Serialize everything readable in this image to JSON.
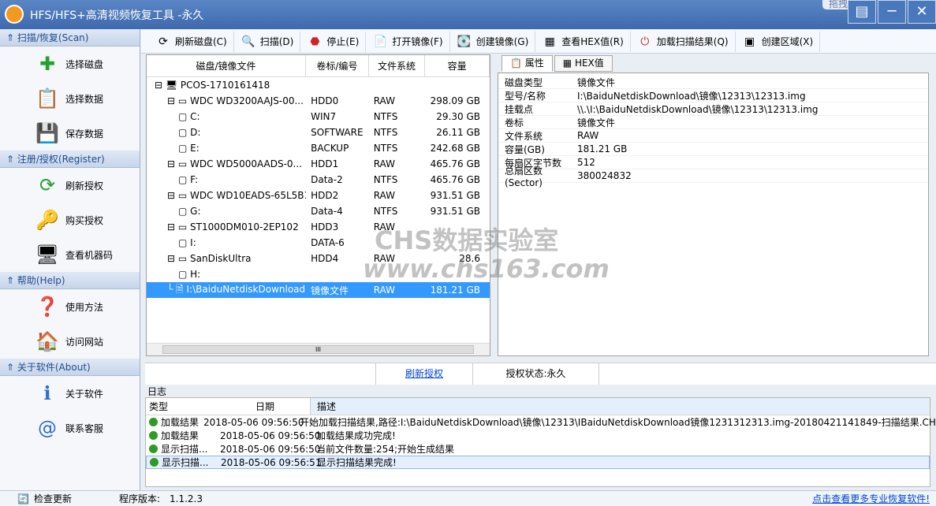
{
  "window": {
    "title": "HFS/HFS+高清视频恢复工具 -永久",
    "tag": "拖拽上传"
  },
  "sidebar": {
    "sections": [
      {
        "title": "扫描/恢复(Scan)",
        "items": [
          "选择磁盘",
          "选择数据",
          "保存数据"
        ]
      },
      {
        "title": "注册/授权(Register)",
        "items": [
          "刷新授权",
          "购买授权",
          "查看机器码"
        ]
      },
      {
        "title": "帮助(Help)",
        "items": [
          "使用方法",
          "访问网站"
        ]
      },
      {
        "title": "关于软件(About)",
        "items": [
          "关于软件",
          "联系客服"
        ]
      }
    ]
  },
  "toolbar": [
    "刷新磁盘(C)",
    "扫描(D)",
    "停止(E)",
    "打开镜像(F)",
    "创建镜像(G)",
    "查看HEX值(R)",
    "加载扫描结果(Q)",
    "创建区域(X)"
  ],
  "tree": {
    "headers": [
      "磁盘/镜像文件",
      "卷标/编号",
      "文件系统",
      "容量"
    ],
    "rows": [
      {
        "name": "PCOS-1710161418",
        "vol": "",
        "fs": "",
        "cap": ""
      },
      {
        "name": "WDC    WD3200AAJS-00...",
        "vol": "HDD0",
        "fs": "RAW",
        "cap": "298.09 GB"
      },
      {
        "name": "C:",
        "vol": "WIN7",
        "fs": "NTFS",
        "cap": "29.30 GB"
      },
      {
        "name": "D:",
        "vol": "SOFTWARE",
        "fs": "NTFS",
        "cap": "26.11 GB"
      },
      {
        "name": "E:",
        "vol": "BACKUP",
        "fs": "NTFS",
        "cap": "242.68 GB"
      },
      {
        "name": "WDC    WD5000AADS-0...",
        "vol": "HDD1",
        "fs": "RAW",
        "cap": "465.76 GB"
      },
      {
        "name": "F:",
        "vol": "Data-2",
        "fs": "NTFS",
        "cap": "465.76 GB"
      },
      {
        "name": "WDC    WD10EADS-65L5B1",
        "vol": "HDD2",
        "fs": "RAW",
        "cap": "931.51 GB"
      },
      {
        "name": "G:",
        "vol": "Data-4",
        "fs": "NTFS",
        "cap": "931.51 GB"
      },
      {
        "name": "ST1000DM010-2EP102",
        "vol": "HDD3",
        "fs": "RAW",
        "cap": ""
      },
      {
        "name": "I:",
        "vol": "DATA-6",
        "fs": "",
        "cap": ""
      },
      {
        "name": "SanDiskUltra",
        "vol": "HDD4",
        "fs": "RAW",
        "cap": "28.6"
      },
      {
        "name": "H:",
        "vol": "",
        "fs": "",
        "cap": ""
      },
      {
        "name": "I:\\BaiduNetdiskDownload...",
        "vol": "镜像文件",
        "fs": "RAW",
        "cap": "181.21 GB"
      }
    ],
    "scroll_mark": "III"
  },
  "props": {
    "tabs": [
      "属性",
      "HEX值"
    ],
    "rows": [
      [
        "磁盘类型",
        "镜像文件"
      ],
      [
        "型号/名称",
        "I:\\BaiduNetdiskDownload\\镜像\\12313\\12313.img"
      ],
      [
        "挂载点",
        "\\\\.\\I:\\BaiduNetdiskDownload\\镜像\\12313\\12313.img"
      ],
      [
        "卷标",
        "镜像文件"
      ],
      [
        "文件系统",
        "RAW"
      ],
      [
        "容量(GB)",
        "181.21 GB"
      ],
      [
        "每扇区字节数",
        "512"
      ],
      [
        "总扇区数(Sector)",
        "380024832"
      ]
    ]
  },
  "status": {
    "refresh": "刷新授权",
    "auth": "授权状态:永久"
  },
  "log": {
    "label": "日志",
    "headers": [
      "类型",
      "日期",
      "描述"
    ],
    "rows": [
      [
        "加载结果",
        "2018-05-06 09:56:50",
        "开始加载扫描结果,路径:I:\\BaiduNetdiskDownload\\镜像\\12313\\IBaiduNetdiskDownload镜像1231312313.img-20180421141849-扫描结果.CHS"
      ],
      [
        "加载结果",
        "2018-05-06 09:56:50",
        "加载结果成功完成!"
      ],
      [
        "显示扫描...",
        "2018-05-06 09:56:50",
        "当前文件数量:254;开始生成结果"
      ],
      [
        "显示扫描...",
        "2018-05-06 09:56:51",
        "显示扫描结果完成!"
      ]
    ]
  },
  "bottom": {
    "check": "检查更新",
    "version_label": "程序版本:",
    "version": "1.1.2.3",
    "more": "点击查看更多专业恢复软件!"
  },
  "watermark": {
    "line1": "CHS数据实验室",
    "line2": "www.chs163.com"
  }
}
